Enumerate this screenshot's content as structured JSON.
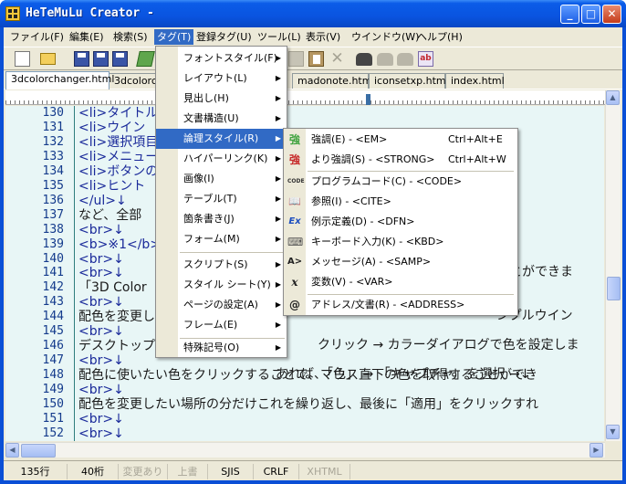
{
  "window": {
    "title": "HeTeMuLu Creator -"
  },
  "menubar": [
    {
      "label": "ファイル(F)"
    },
    {
      "label": "編集(E)"
    },
    {
      "label": "検索(S)"
    },
    {
      "label": "タグ(T)"
    },
    {
      "label": "登録タグ(U)"
    },
    {
      "label": "ツール(L)"
    },
    {
      "label": "表示(V)"
    },
    {
      "label": "ウインドウ(W)"
    },
    {
      "label": "ヘルプ(H)"
    }
  ],
  "tabs": [
    {
      "label": "3dcolorchanger.html"
    },
    {
      "label": "3dcolorch"
    },
    {
      "label": "madonote.html"
    },
    {
      "label": "iconsetxp.html"
    },
    {
      "label": "index.html"
    }
  ],
  "editor": {
    "lines": [
      {
        "num": "130",
        "text": "<li>タイトル"
      },
      {
        "num": "131",
        "text": "<li>ウイン"
      },
      {
        "num": "132",
        "text": "<li>選択項目"
      },
      {
        "num": "133",
        "text": "<li>メニュー"
      },
      {
        "num": "134",
        "text": "<li>ボタンの"
      },
      {
        "num": "135",
        "text": "<li>ヒント"
      },
      {
        "num": "136",
        "text": "</ul>↓"
      },
      {
        "num": "137",
        "text": "など、全部"
      },
      {
        "num": "138",
        "text": "<br>↓"
      },
      {
        "num": "139",
        "text": "<b>※1</b>"
      },
      {
        "num": "140",
        "text": "<br>↓"
      },
      {
        "num": "141",
        "text": "<br>↓"
      },
      {
        "num": "142",
        "text": "「3D Color"
      },
      {
        "num": "143",
        "text": "<br>↓"
      },
      {
        "num": "144",
        "text": "配色を変更し"
      },
      {
        "num": "145",
        "text": "<br>↓"
      },
      {
        "num": "146",
        "text": "デスクトップ"
      },
      {
        "num": "147",
        "text": "<br>↓"
      },
      {
        "num": "148",
        "text": "配色に使いたい色をクリックすることで、マウス直下の色を取得することができ"
      },
      {
        "num": "149",
        "text": "<br>↓"
      },
      {
        "num": "150",
        "text": "配色を変更したい場所の分だけこれを繰り返し、最後に「適用」をクリックすれ"
      },
      {
        "num": "151",
        "text": "<br>↓"
      },
      {
        "num": "152",
        "text": "<br>↓"
      }
    ],
    "overflow": [
      {
        "text": "ことができま"
      },
      {
        "text": "ンプルウイン"
      },
      {
        "text": "クリック → カラーダイアログで色を設定しま"
      },
      {
        "text": "あれば、「色」 → 「キャプチャ」を選択 →↓"
      }
    ]
  },
  "tag_menu": {
    "items": [
      {
        "label": "フォントスタイル(F)"
      },
      {
        "label": "レイアウト(L)"
      },
      {
        "label": "見出し(H)"
      },
      {
        "label": "文書構造(U)"
      },
      {
        "label": "論理スタイル(R)"
      },
      {
        "label": "ハイパーリンク(K)"
      },
      {
        "label": "画像(I)"
      },
      {
        "label": "テーブル(T)"
      },
      {
        "label": "箇条書き(J)"
      },
      {
        "label": "フォーム(M)"
      },
      {
        "label": "スクリプト(S)"
      },
      {
        "label": "スタイル シート(Y)"
      },
      {
        "label": "ページの設定(A)"
      },
      {
        "label": "フレーム(E)"
      },
      {
        "label": "特殊記号(O)"
      }
    ]
  },
  "logical_style_menu": {
    "items": [
      {
        "label": "強調(E) - <EM>",
        "shortcut": "Ctrl+Alt+E",
        "icon": "強"
      },
      {
        "label": "より強調(S) - <STRONG>",
        "shortcut": "Ctrl+Alt+W",
        "icon": "強"
      },
      {
        "label": "プログラムコード(C) - <CODE>",
        "shortcut": "",
        "icon": "CODE"
      },
      {
        "label": "参照(I) - <CITE>",
        "shortcut": "",
        "icon": "📖"
      },
      {
        "label": "例示定義(D) - <DFN>",
        "shortcut": "",
        "icon": "Ex"
      },
      {
        "label": "キーボード入力(K) - <KBD>",
        "shortcut": "",
        "icon": "⌨"
      },
      {
        "label": "メッセージ(A) - <SAMP>",
        "shortcut": "",
        "icon": "A>"
      },
      {
        "label": "変数(V) - <VAR>",
        "shortcut": "",
        "icon": "x"
      },
      {
        "label": "アドレス/文書(R) - <ADDRESS>",
        "shortcut": "",
        "icon": "@"
      }
    ]
  },
  "statusbar": [
    {
      "label": "135行"
    },
    {
      "label": "40桁"
    },
    {
      "label": "変更あり"
    },
    {
      "label": "上書"
    },
    {
      "label": "SJIS"
    },
    {
      "label": "CRLF"
    },
    {
      "label": "XHTML"
    }
  ],
  "colors": {
    "titlebar": "#0a54e0",
    "highlight": "#316ac5",
    "editor_bg": "#e8f6f6"
  }
}
